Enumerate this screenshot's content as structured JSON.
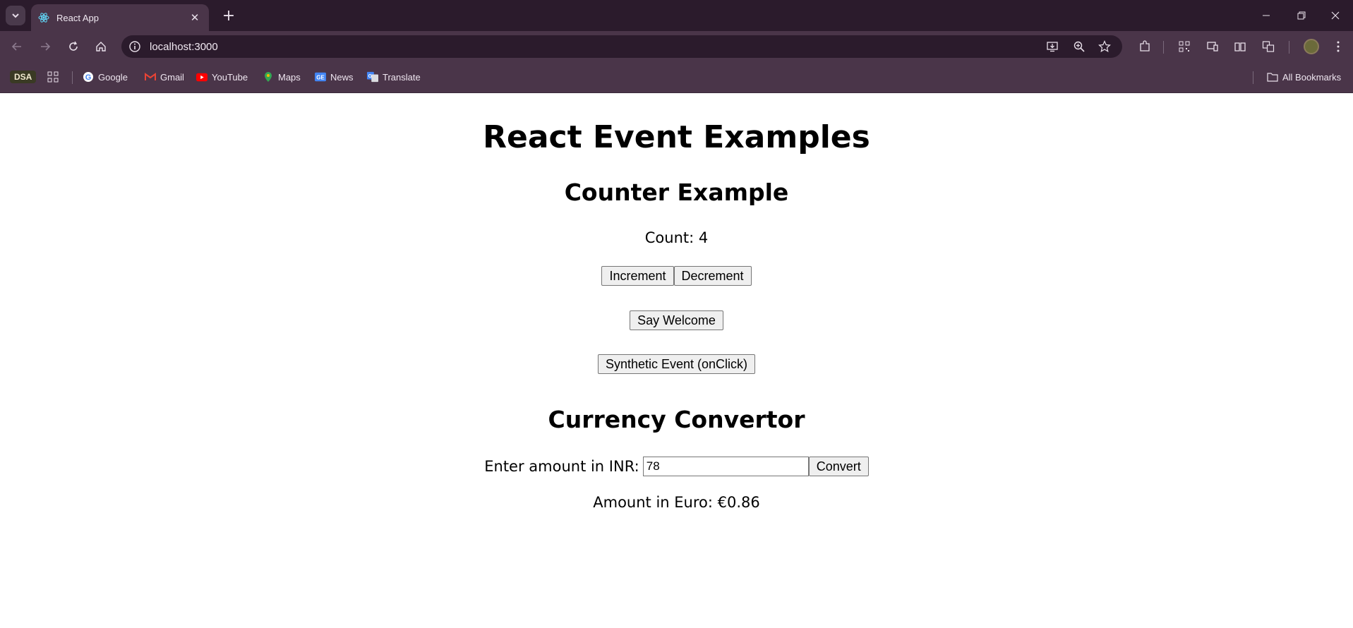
{
  "browser": {
    "tab_title": "React App",
    "url": "localhost:3000",
    "bookmarks": [
      {
        "label": "DSA"
      },
      {
        "label": "Google"
      },
      {
        "label": "Gmail"
      },
      {
        "label": "YouTube"
      },
      {
        "label": "Maps"
      },
      {
        "label": "News"
      },
      {
        "label": "Translate"
      }
    ],
    "all_bookmarks_label": "All Bookmarks"
  },
  "page": {
    "title": "React Event Examples",
    "counter": {
      "heading": "Counter Example",
      "count_text": "Count: 4",
      "increment_label": "Increment",
      "decrement_label": "Decrement"
    },
    "welcome_label": "Say Welcome",
    "synthetic_label": "Synthetic Event (onClick)",
    "currency": {
      "heading": "Currency Convertor",
      "input_label": "Enter amount in INR:",
      "input_value": "78",
      "convert_label": "Convert",
      "result_text": "Amount in Euro: €0.86"
    }
  }
}
